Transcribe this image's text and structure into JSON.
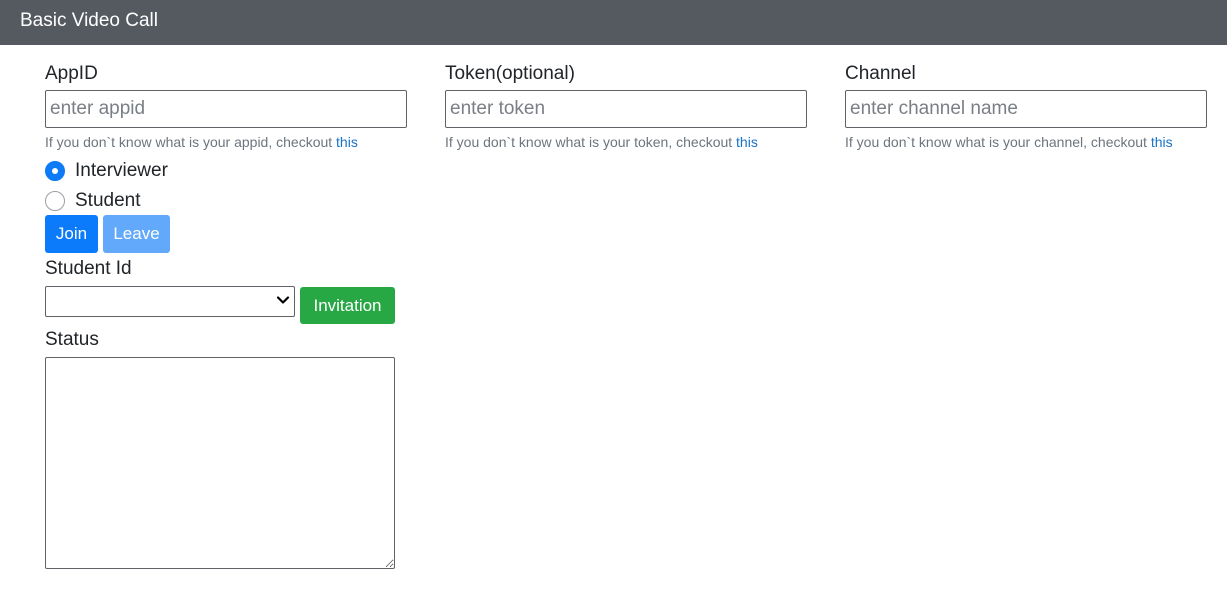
{
  "header": {
    "title": "Basic Video Call"
  },
  "form": {
    "appid": {
      "label": "AppID",
      "placeholder": "enter appid",
      "value": "",
      "help_prefix": "If you don`t know what is your appid, checkout ",
      "help_link": "this"
    },
    "token": {
      "label": "Token(optional)",
      "placeholder": "enter token",
      "value": "",
      "help_prefix": "If you don`t know what is your token, checkout ",
      "help_link": "this"
    },
    "channel": {
      "label": "Channel",
      "placeholder": "enter channel name",
      "value": "",
      "help_prefix": "If you don`t know what is your channel, checkout ",
      "help_link": "this"
    },
    "role": {
      "options": [
        {
          "label": "Interviewer",
          "checked": true
        },
        {
          "label": "Student",
          "checked": false
        }
      ]
    },
    "buttons": {
      "join": "Join",
      "leave": "Leave",
      "invitation": "Invitation"
    },
    "student_id": {
      "label": "Student Id",
      "selected": ""
    },
    "status": {
      "label": "Status",
      "value": ""
    }
  },
  "colors": {
    "header_bg": "#545a60",
    "primary": "#0b7bfb",
    "primary_disabled": "#62a9fb",
    "success": "#28a745",
    "link": "#1a73c9"
  },
  "icons": {
    "select_arrow": "chevron-down-icon"
  }
}
